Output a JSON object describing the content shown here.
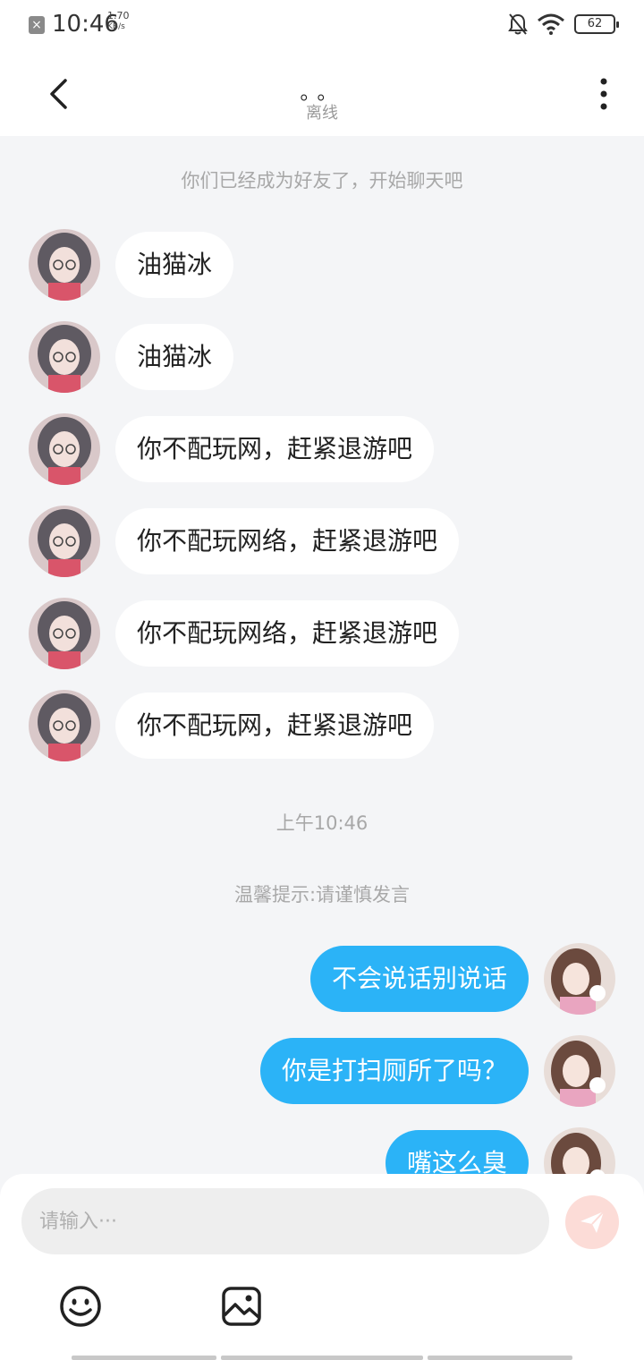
{
  "status_bar": {
    "time": "10:46",
    "net_speed_value": "1.70",
    "net_speed_unit": "KB/s",
    "battery": "62"
  },
  "header": {
    "title": "。。",
    "subtitle": "离线"
  },
  "notices": {
    "friend_added": "你们已经成为好友了，开始聊天吧",
    "timestamp": "上午10:46",
    "warning": "温馨提示:请谨慎发言"
  },
  "messages_received": [
    {
      "text": "油猫冰"
    },
    {
      "text": "油猫冰"
    },
    {
      "text": "你不配玩网，赶紧退游吧"
    },
    {
      "text": "你不配玩网络，赶紧退游吧"
    },
    {
      "text": "你不配玩网络，赶紧退游吧"
    },
    {
      "text": "你不配玩网，赶紧退游吧"
    }
  ],
  "messages_sent": [
    {
      "text": "不会说话别说话"
    },
    {
      "text": "你是打扫厕所了吗？"
    },
    {
      "text": "嘴这么臭"
    }
  ],
  "composer": {
    "placeholder": "请输入···"
  },
  "icons": {
    "back": "chevron-left-icon",
    "more": "more-vertical-icon",
    "send": "paper-plane-icon",
    "emoji": "smiley-icon",
    "image": "image-icon"
  },
  "colors": {
    "sent_bubble": "#2bb3f7",
    "received_bubble": "#ffffff",
    "background": "#f4f5f7",
    "send_button": "#fcdcd7"
  }
}
